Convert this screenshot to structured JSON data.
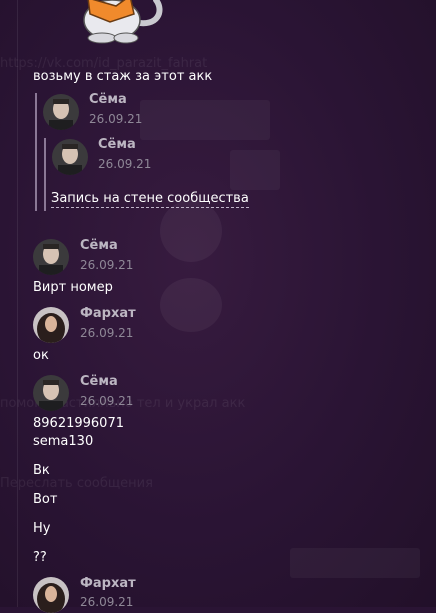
{
  "background_ghosts": [
    "https://vk.com/id_parazit_fahrat",
    "Переслать сообщения",
    "помог спастилльно тел и укpал акк"
  ],
  "messages": [
    {
      "text": "возьму в стаж за этот акк"
    },
    {
      "author": "Сёма",
      "date": "26.09.21"
    },
    {
      "author": "Сёма",
      "date": "26.09.21"
    },
    {
      "link": "Запись на стене сообщества"
    },
    {
      "author": "Сёма",
      "date": "26.09.21"
    },
    {
      "text": "Вирт номер"
    },
    {
      "author": "Фархат",
      "date": "26.09.21"
    },
    {
      "text": "ок"
    },
    {
      "author": "Сёма",
      "date": "26.09.21"
    },
    {
      "text": "89621996071"
    },
    {
      "text": "sema130"
    },
    {
      "text": "Вк"
    },
    {
      "text": "Вот"
    },
    {
      "text": "Ну"
    },
    {
      "text": "??"
    },
    {
      "author": "Фархат",
      "date": "26.09.21"
    }
  ],
  "colors": {
    "background": "#2a1434",
    "author": "#bcb6c2",
    "date": "#8f8897",
    "text": "#ffffff",
    "quote_bar": "#8b7896"
  }
}
